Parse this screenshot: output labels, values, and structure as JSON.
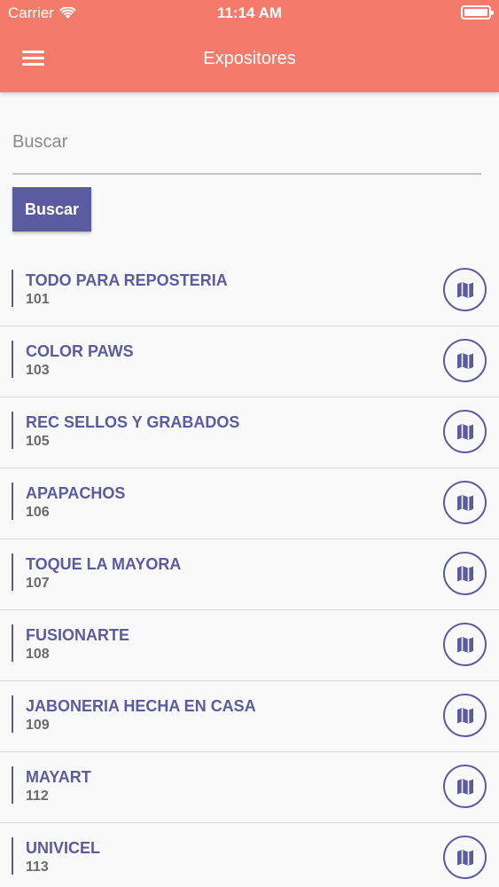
{
  "status_bar": {
    "carrier": "Carrier",
    "time": "11:14 AM"
  },
  "nav": {
    "title": "Expositores",
    "menu_icon": "hamburger-icon"
  },
  "search": {
    "placeholder": "Buscar",
    "value": "",
    "button_label": "Buscar"
  },
  "colors": {
    "header": "#f47a6c",
    "accent": "#5a5ba0",
    "background": "#f9f9f9"
  },
  "exhibitors": [
    {
      "name": "TODO PARA REPOSTERIA",
      "number": "101",
      "icon": "map-icon"
    },
    {
      "name": "COLOR PAWS",
      "number": "103",
      "icon": "map-icon"
    },
    {
      "name": "REC SELLOS Y GRABADOS",
      "number": "105",
      "icon": "map-icon"
    },
    {
      "name": "APAPACHOS",
      "number": "106",
      "icon": "map-icon"
    },
    {
      "name": "TOQUE LA MAYORA",
      "number": "107",
      "icon": "map-icon"
    },
    {
      "name": "FUSIONARTE",
      "number": "108",
      "icon": "map-icon"
    },
    {
      "name": "JABONERIA HECHA EN CASA",
      "number": "109",
      "icon": "map-icon"
    },
    {
      "name": "MAYART",
      "number": "112",
      "icon": "map-icon"
    },
    {
      "name": "UNIVICEL",
      "number": "113",
      "icon": "map-icon"
    }
  ]
}
